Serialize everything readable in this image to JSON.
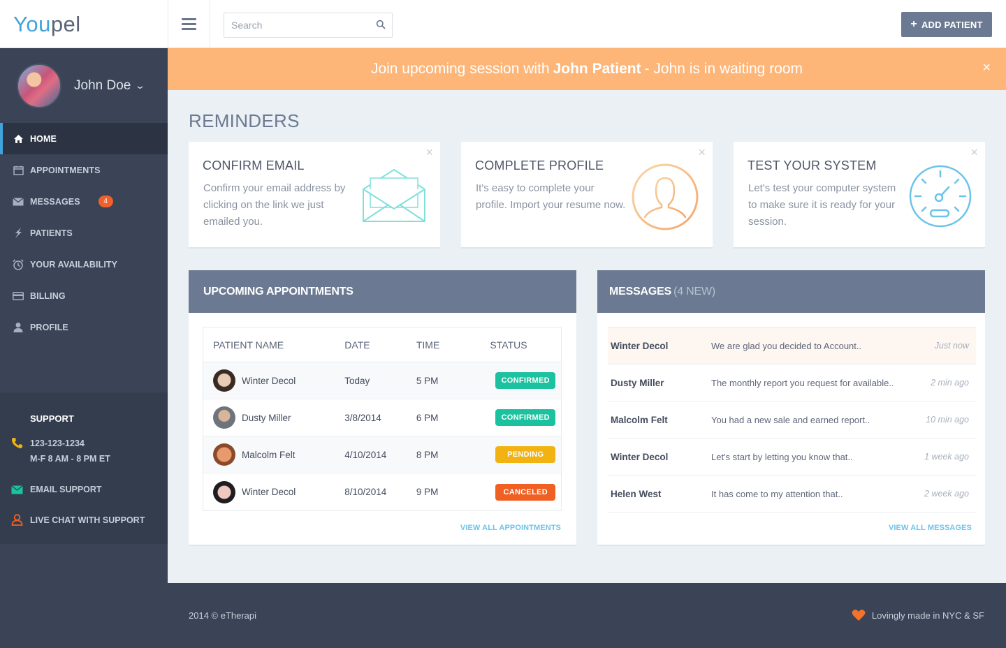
{
  "app": {
    "logo_part1": "You",
    "logo_part2": "pel"
  },
  "topbar": {
    "search_placeholder": "Search",
    "add_patient_label": "ADD PATIENT"
  },
  "user": {
    "name": "John Doe"
  },
  "sidebar": {
    "items": [
      {
        "label": "HOME",
        "icon": "home-icon",
        "active": true
      },
      {
        "label": "APPOINTMENTS",
        "icon": "calendar-icon"
      },
      {
        "label": "MESSAGES",
        "icon": "envelope-icon",
        "badge": "4"
      },
      {
        "label": "PATIENTS",
        "icon": "lightning-icon"
      },
      {
        "label": "YOUR AVAILABILITY",
        "icon": "alarm-clock-icon"
      },
      {
        "label": "BILLING",
        "icon": "credit-card-icon"
      },
      {
        "label": "PROFILE",
        "icon": "user-icon"
      }
    ],
    "support": {
      "title": "SUPPORT",
      "phone": "123-123-1234",
      "hours": "M-F 8 AM - 8 PM  ET",
      "email": "EMAIL SUPPORT",
      "chat": "LIVE CHAT WITH SUPPORT"
    }
  },
  "banner": {
    "prefix": "Join upcoming session with",
    "patient": "John Patient",
    "suffix": "- John is in waiting room",
    "close": "×"
  },
  "reminders": {
    "title": "REMINDERS",
    "cards": [
      {
        "title": "CONFIRM EMAIL",
        "text": "Confirm your email address by clicking on the link we just emailed you.",
        "icon": "envelope-open-icon",
        "accent": "#7fe0dc"
      },
      {
        "title": "COMPLETE PROFILE",
        "text": "It's easy to complete your profile. Import your resume now.",
        "icon": "profile-silhouette-icon",
        "accent": "#f6bd72"
      },
      {
        "title": "TEST YOUR SYSTEM",
        "text": "Let's test your computer system to make sure it is ready for your session.",
        "icon": "speedometer-icon",
        "accent": "#6cc3ea"
      }
    ],
    "close": "×"
  },
  "appointments": {
    "title": "UPCOMING APPOINTMENTS",
    "columns": [
      "PATIENT NAME",
      "DATE",
      "TIME",
      "STATUS"
    ],
    "rows": [
      {
        "name": "Winter Decol",
        "date": "Today",
        "time": "5 PM",
        "status": "CONFIRMED"
      },
      {
        "name": "Dusty Miller",
        "date": "3/8/2014",
        "time": "6 PM",
        "status": "CONFIRMED"
      },
      {
        "name": "Malcolm Felt",
        "date": "4/10/2014",
        "time": "8 PM",
        "status": "PENDING"
      },
      {
        "name": "Winter Decol",
        "date": "8/10/2014",
        "time": "9 PM",
        "status": "CANCELED"
      }
    ],
    "view_all": "VIEW ALL APPOINTMENTS"
  },
  "messages": {
    "title": "MESSAGES",
    "new_count": "(4 NEW)",
    "rows": [
      {
        "from": "Winter Decol",
        "text": "We are glad you decided to Account..",
        "time": "Just now"
      },
      {
        "from": "Dusty Miller",
        "text": "The monthly report you request for available..",
        "time": "2 min ago"
      },
      {
        "from": "Malcolm Felt",
        "text": "You had a new sale and earned report..",
        "time": "10 min ago"
      },
      {
        "from": "Winter Decol",
        "text": "Let's start by letting you know that..",
        "time": "1 week ago"
      },
      {
        "from": "Helen West",
        "text": " It has come to my attention that..",
        "time": "2 week ago"
      }
    ],
    "view_all": "VIEW ALL MESSAGES"
  },
  "footer": {
    "copyright": "2014 © eTherapi",
    "made": "Lovingly made in NYC & SF"
  },
  "colors": {
    "brand_blue": "#3fa3dc",
    "sidebar": "#3a4456",
    "banner": "#fdb578",
    "panel_header": "#6b7a92",
    "confirmed": "#1cc29f",
    "pending": "#f2b312",
    "canceled": "#f06022"
  }
}
